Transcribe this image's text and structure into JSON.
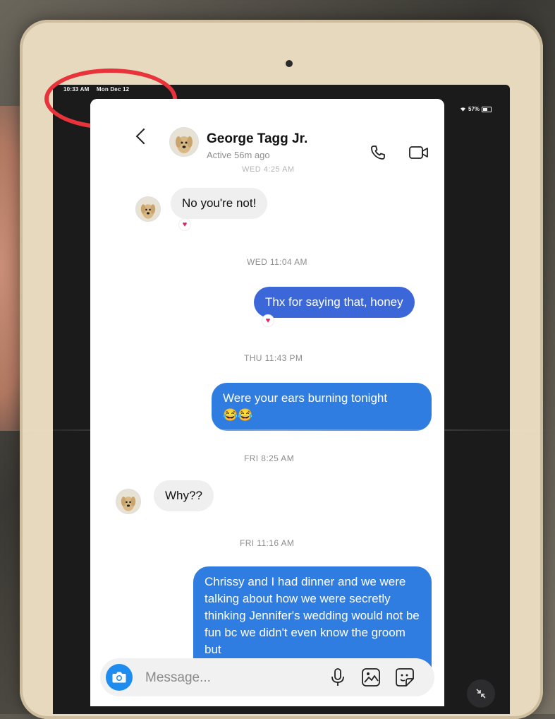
{
  "status_bar": {
    "time": "10:33 AM",
    "date": "Mon Dec 12",
    "battery": "57%"
  },
  "header": {
    "contact_name": "George Tagg Jr.",
    "contact_status": "Active 56m ago"
  },
  "chat": {
    "partial_timestamp": "WED 4:25 AM",
    "messages": [
      {
        "direction": "in",
        "text": "No you're not!",
        "reaction": "heart"
      },
      {
        "timestamp": "WED 11:04 AM"
      },
      {
        "direction": "out",
        "text": "Thx for saying that, honey",
        "reaction": "heart"
      },
      {
        "timestamp": "THU 11:43 PM"
      },
      {
        "direction": "out",
        "text": "Were your ears burning tonight",
        "emoji": "😂😂"
      },
      {
        "timestamp": "FRI 8:25 AM"
      },
      {
        "direction": "in",
        "text": "Why??"
      },
      {
        "timestamp": "FRI 11:16 AM"
      },
      {
        "direction": "out",
        "text": "Chrissy and I had dinner and we were talking about how we were secretly thinking Jennifer's wedding would not be fun bc we didn't even know the groom but"
      }
    ]
  },
  "composer": {
    "placeholder": "Message..."
  },
  "icons": {
    "back": "chevron-left-icon",
    "call": "phone-icon",
    "video": "video-camera-icon",
    "camera": "camera-icon",
    "mic": "microphone-icon",
    "gallery": "image-icon",
    "sticker": "sticker-icon",
    "reaction": "heart-icon",
    "minimize": "minimize-arrows-icon"
  },
  "colors": {
    "outgoing_bubble": "#3c67d8",
    "incoming_bubble": "#efefef",
    "camera_button": "#1f8cf0",
    "annotation_circle": "#e8333a",
    "heart": "#e0245e"
  }
}
